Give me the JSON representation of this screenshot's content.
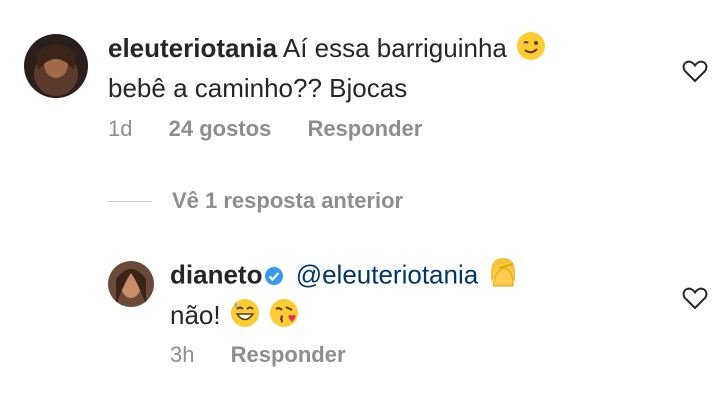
{
  "comment1": {
    "username": "eleuteriotania",
    "text_line1": "Aí essa barriguinha",
    "text_line2": "bebê a caminho?? Bjocas",
    "emoji1": "wink-emoji",
    "time": "1d",
    "likes": "24 gostos",
    "reply_label": "Responder"
  },
  "view_replies": "Vê 1 resposta anterior",
  "comment2": {
    "username": "dianeto",
    "mention": "@eleuteriotania",
    "text": "não!",
    "emoji_facepalm": "woman-facepalming-emoji",
    "emoji_sweat": "grinning-sweat-emoji",
    "emoji_kiss": "face-blowing-kiss-emoji",
    "time": "3h",
    "reply_label": "Responder"
  },
  "colors": {
    "text": "#262626",
    "meta": "#8e8e8e",
    "mention": "#00376b",
    "verified": "#3897f0"
  }
}
